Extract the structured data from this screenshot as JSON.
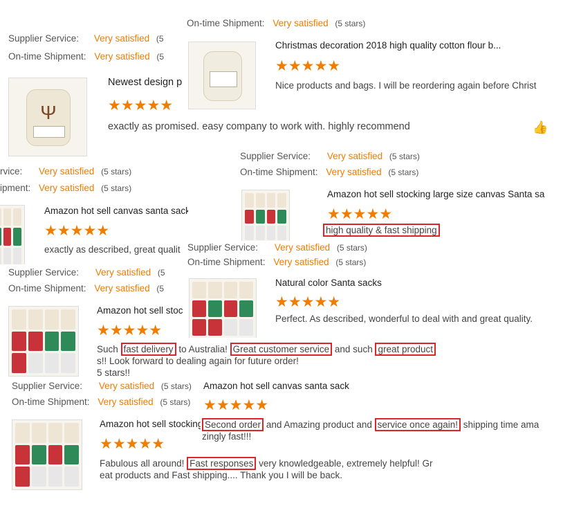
{
  "labels": {
    "supplier": "Supplier Service:",
    "shipment": "On-time Shipment:",
    "supplier_cut": "rvice:",
    "shipment_cut": "ipment:",
    "very_satisfied": "Very satisfied",
    "five_stars": "(5 stars)",
    "paren_five": "(5"
  },
  "stars": "★★★★★",
  "reviews": [
    {
      "title": "Newest design p",
      "comment": "exactly as promised. easy company to work with. highly recommend"
    },
    {
      "title": "Christmas decoration 2018 high quality cotton flour b...",
      "comment": "Nice products and bags. I will be reordering again before Christ"
    },
    {
      "title": "Amazon hot sell canvas santa sack",
      "comment": "exactly as described, great qualit"
    },
    {
      "title": "Amazon hot sell stocking large size canvas Santa sa",
      "comment": "high quality & fast shipping"
    },
    {
      "title": "Amazon hot sell stoc",
      "comment_parts": [
        "Such ",
        "fast delivery",
        " to Australia! ",
        "Great customer service",
        " and such ",
        "great product"
      ],
      "comment_line2": "s!! Look forward to dealing again for future order!",
      "comment_line3": "5 stars!!"
    },
    {
      "title": "Natural color Santa sacks",
      "comment": "Perfect. As described, wonderful to deal with and great quality."
    },
    {
      "title": "Amazon hot sell stocking",
      "comment_parts": [
        "Fabulous all around! ",
        "Fast responses",
        " very knowledgeable, extremely helpful! Gr"
      ],
      "comment_line2": "eat products and Fast shipping.... Thank you I will be back."
    },
    {
      "title": "Amazon hot sell canvas santa sack",
      "comment_parts": [
        "Second order",
        " and Amazing product and ",
        "service once again!",
        " shipping time ama"
      ],
      "comment_line2": "zingly fast!!!"
    }
  ],
  "icons": {
    "thumb": "thumbs-up-icon",
    "antler": "antler-icon"
  }
}
